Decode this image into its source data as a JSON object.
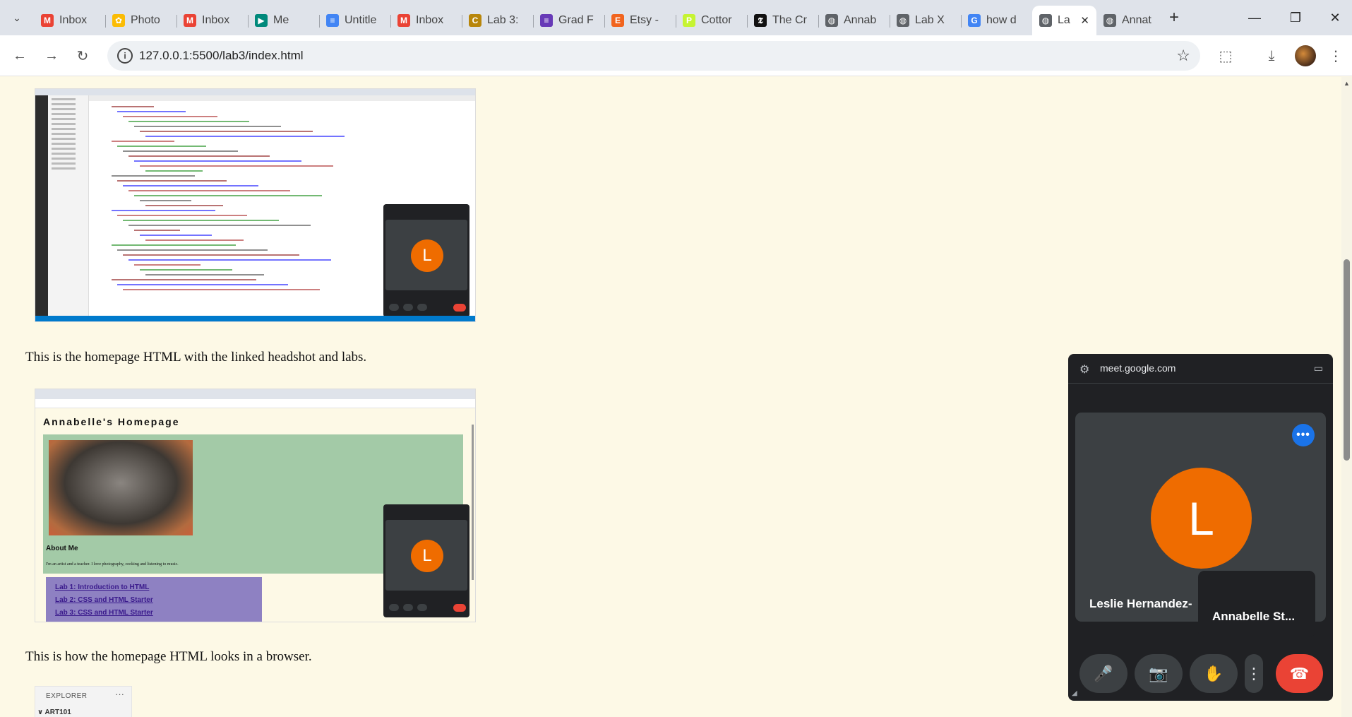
{
  "tabs": [
    {
      "label": "Inbox",
      "icon": "gmail-icon",
      "color": "#ea4335",
      "glyph": "M"
    },
    {
      "label": "Photo",
      "icon": "photos-icon",
      "color": "#fbbc04",
      "glyph": "✿"
    },
    {
      "label": "Inbox",
      "icon": "gmail-icon",
      "color": "#ea4335",
      "glyph": "M"
    },
    {
      "label": "Me",
      "icon": "meet-icon",
      "color": "#00897b",
      "glyph": "▶"
    },
    {
      "label": "Untitle",
      "icon": "docs-icon",
      "color": "#4285f4",
      "glyph": "≡"
    },
    {
      "label": "Inbox",
      "icon": "gmail-icon",
      "color": "#ea4335",
      "glyph": "M"
    },
    {
      "label": "Lab 3:",
      "icon": "csu-icon",
      "color": "#b8860b",
      "glyph": "C"
    },
    {
      "label": "Grad F",
      "icon": "forms-icon",
      "color": "#673ab7",
      "glyph": "≡"
    },
    {
      "label": "Etsy -",
      "icon": "etsy-icon",
      "color": "#f1641e",
      "glyph": "E"
    },
    {
      "label": "Cottor",
      "icon": "p-icon",
      "color": "#c6f432",
      "glyph": "P"
    },
    {
      "label": "The Cr",
      "icon": "nyt-icon",
      "color": "#111111",
      "glyph": "𝕿"
    },
    {
      "label": "Annab",
      "icon": "globe-icon",
      "color": "#5f6368",
      "glyph": "◍"
    },
    {
      "label": "Lab X",
      "icon": "globe-icon",
      "color": "#5f6368",
      "glyph": "◍"
    },
    {
      "label": "how d",
      "icon": "google-icon",
      "color": "#4285f4",
      "glyph": "G"
    },
    {
      "label": "La",
      "icon": "globe-icon",
      "color": "#5f6368",
      "glyph": "◍",
      "active": true
    },
    {
      "label": "Annat",
      "icon": "globe-icon",
      "color": "#5f6368",
      "glyph": "◍"
    }
  ],
  "window_controls": {
    "minimize": "—",
    "restore": "❐",
    "close": "✕"
  },
  "toolbar": {
    "url": "127.0.0.1:5500/lab3/index.html",
    "back": "←",
    "forward": "→",
    "reload": "↻",
    "star": "☆",
    "extensions": "⬚",
    "download": "⤓",
    "menu": "⋮"
  },
  "page": {
    "caption1": "This is the homepage HTML with the linked headshot and labs.",
    "caption2": "This is how the homepage HTML looks in a browser.",
    "vscode_shot": {
      "pip_initial": "L"
    },
    "browser_shot": {
      "title": "Annabelle's Homepage",
      "about_title": "About Me",
      "about_text": "I'm an artist and a teacher. I love photography, cooking and listening to music.",
      "links": [
        "Lab 1: Introduction to HTML",
        "Lab 2: CSS and HTML Starter",
        "Lab 3: CSS and HTML Starter"
      ],
      "pip_initial": "L"
    },
    "explorer": {
      "header": "EXPLORER",
      "more": "···",
      "folder": "∨ ART101"
    }
  },
  "pip": {
    "origin": "meet.google.com",
    "initial": "L",
    "participant_name": "Leslie Hernandez-",
    "self_name": "Annabelle St...",
    "more": "•••",
    "controls": {
      "mic": "🎤",
      "camera": "📷",
      "hand": "✋",
      "more": "⋮",
      "end": "☎"
    },
    "accent": "#ef6c00",
    "end_color": "#ea4335"
  }
}
